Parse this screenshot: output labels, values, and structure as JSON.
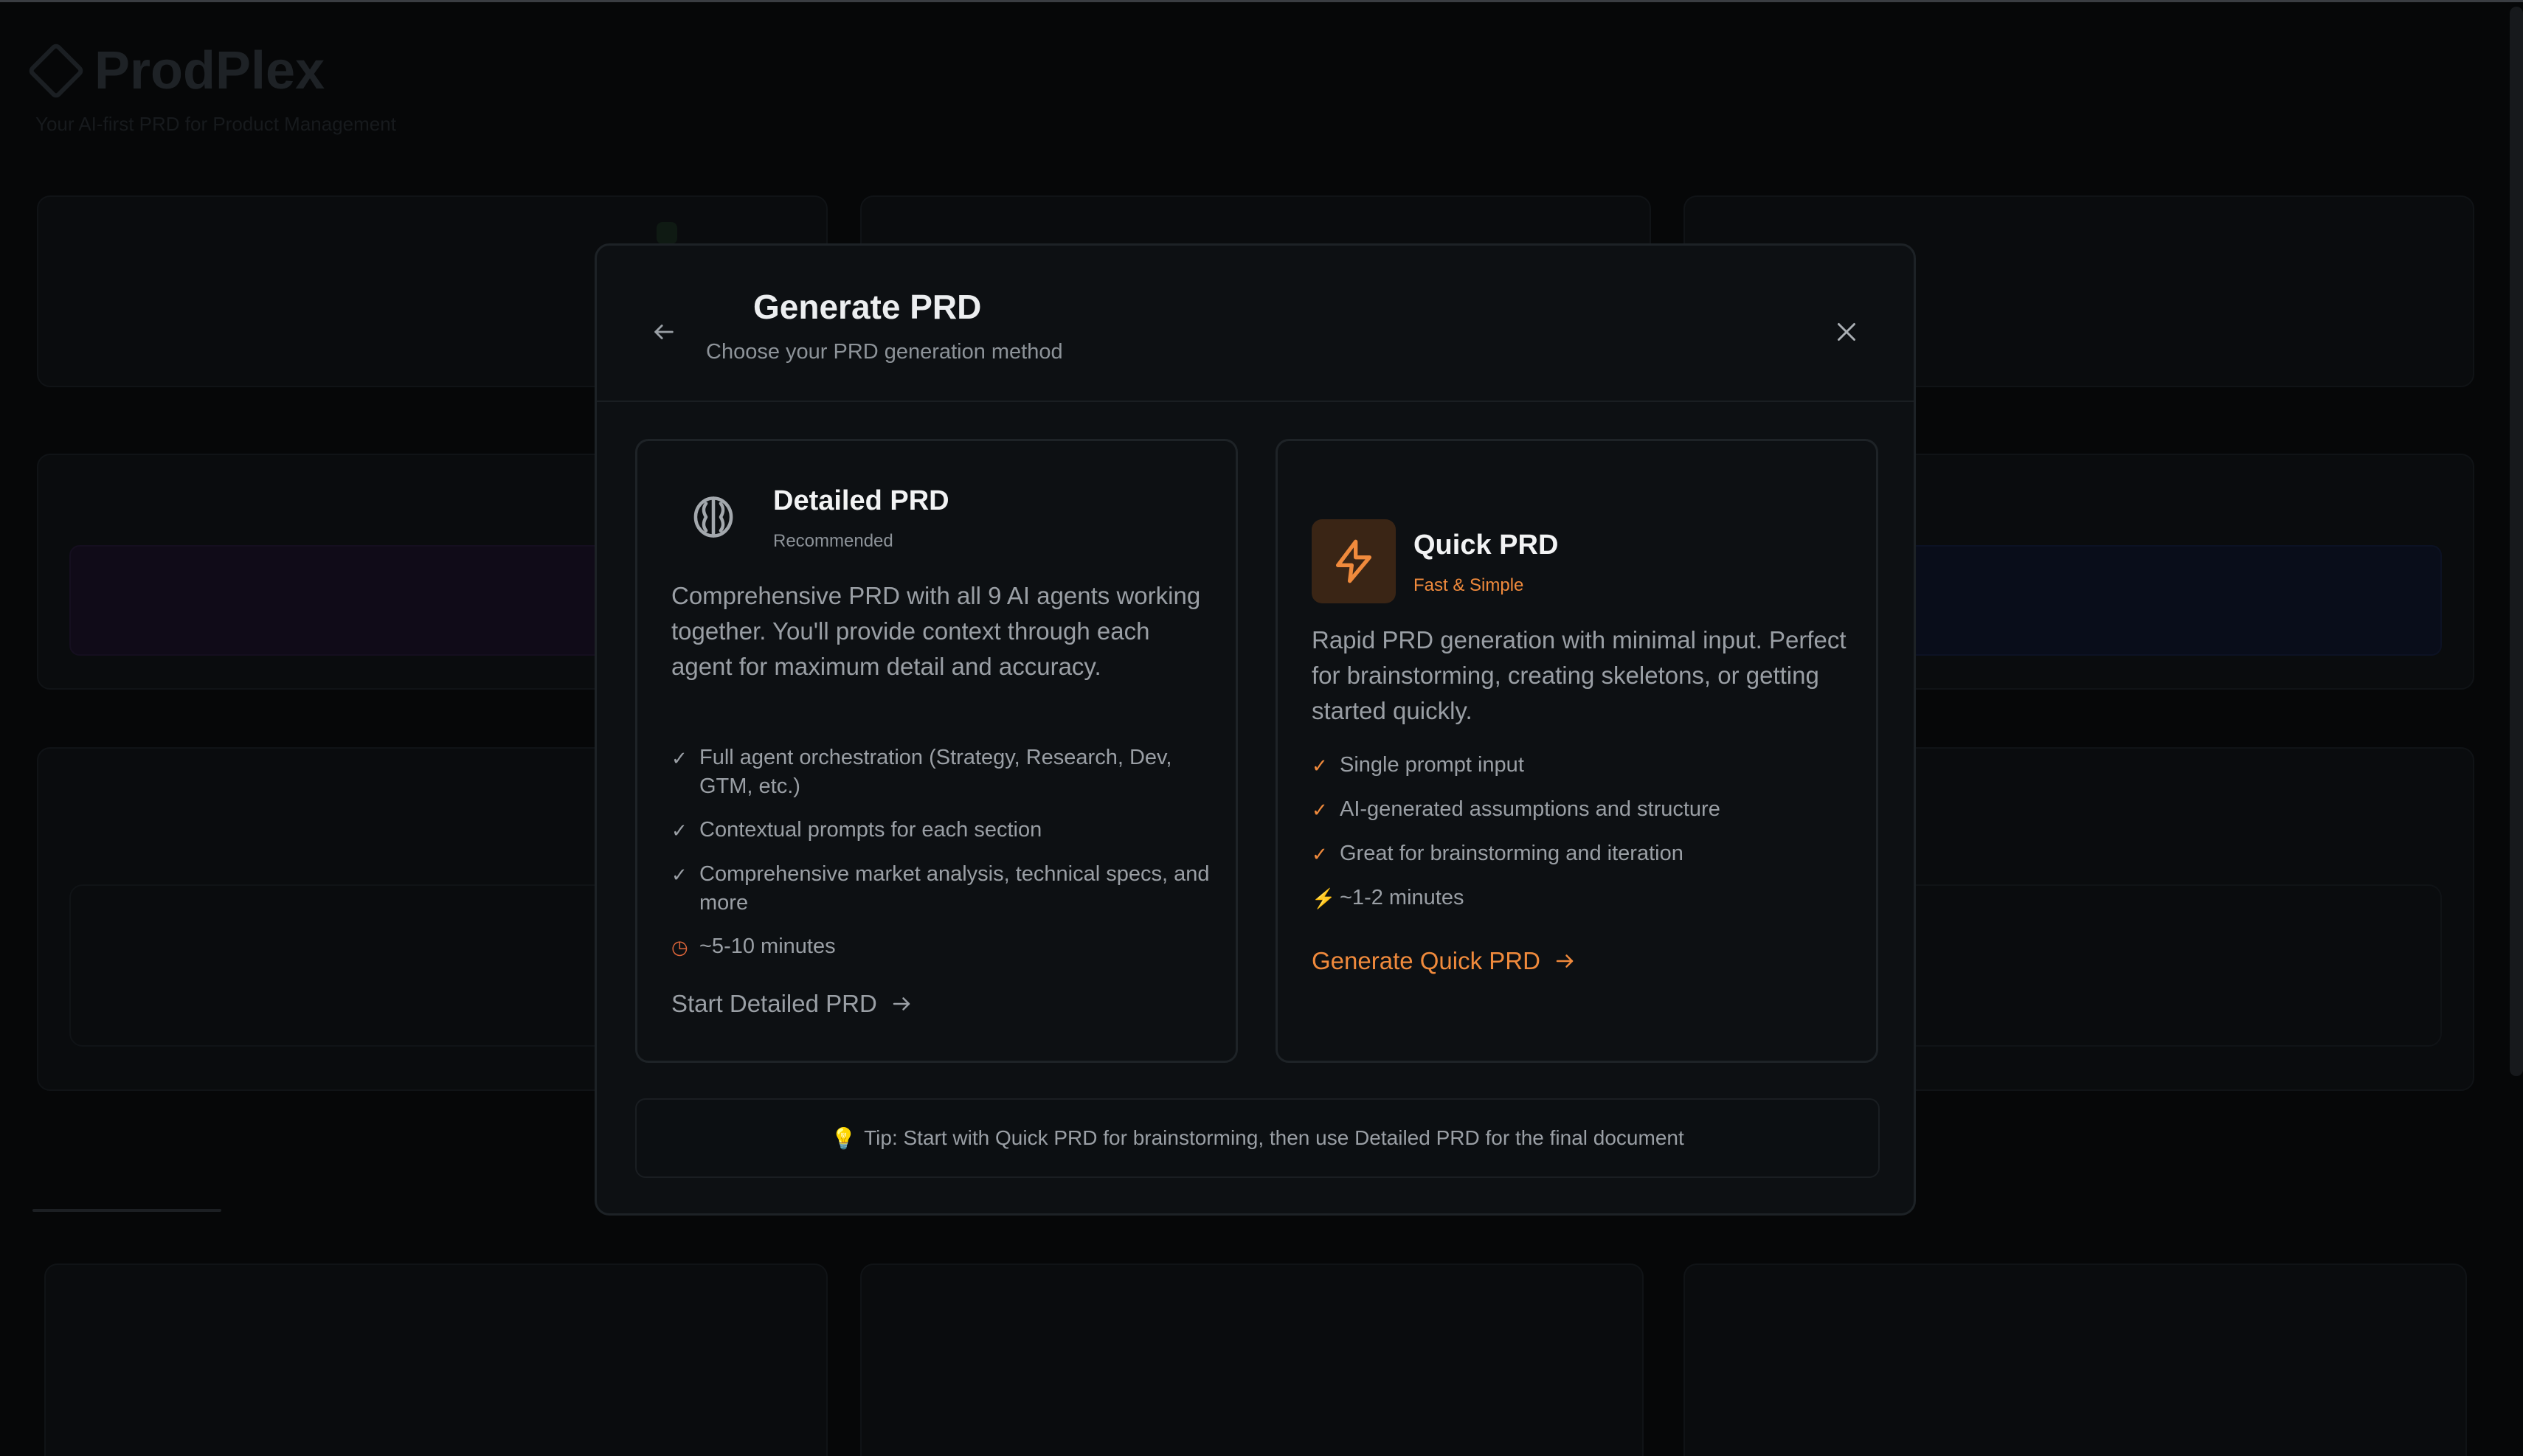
{
  "background": {
    "app_title": "ProdPlex",
    "app_subtitle": "Your AI-first PRD for Product Management"
  },
  "modal": {
    "title": "Generate PRD",
    "subtitle": "Choose your PRD generation method",
    "back_icon": "arrow-left-icon",
    "close_icon": "close-icon"
  },
  "detailed": {
    "icon": "brain-icon",
    "title": "Detailed PRD",
    "tag": "Recommended",
    "description": "Comprehensive PRD with all 9 AI agents working together. You'll provide context through each agent for maximum detail and accuracy.",
    "features": [
      "Full agent orchestration (Strategy, Research, Dev, GTM, etc.)",
      "Contextual prompts for each section",
      "Comprehensive market analysis, technical specs, and more"
    ],
    "time": "~5-10 minutes",
    "action": "Start Detailed PRD"
  },
  "quick": {
    "icon": "lightning-icon",
    "title": "Quick PRD",
    "tag": "Fast & Simple",
    "description": "Rapid PRD generation with minimal input. Perfect for brainstorming, creating skeletons, or getting started quickly.",
    "features": [
      "Single prompt input",
      "AI-generated assumptions and structure",
      "Great for brainstorming and iteration"
    ],
    "time": "~1-2 minutes",
    "action": "Generate Quick PRD"
  },
  "tip": "Tip: Start with Quick PRD for brainstorming, then use Detailed PRD for the final document",
  "colors": {
    "accent_orange": "#f08a3c",
    "modal_bg": "#0d1013",
    "page_bg": "#060708"
  }
}
